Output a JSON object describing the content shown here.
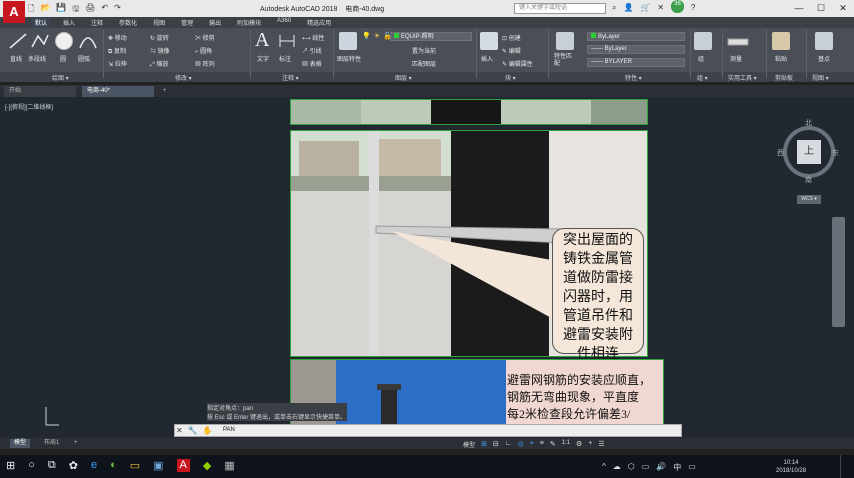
{
  "titlebar": {
    "app_logo": "A",
    "qat_icons": [
      "new-icon",
      "open-icon",
      "save-icon",
      "saveas-icon",
      "print-icon",
      "undo-icon",
      "redo-icon"
    ],
    "qat_glyphs": [
      "🗋",
      "📂",
      "💾",
      "🖫",
      "🖨",
      "↶",
      "↷"
    ],
    "title": "Autodesk AutoCAD 2018    电商-40.dwg",
    "search_placeholder": "键入关键字或短语",
    "badge_count": "36",
    "controls": [
      "—",
      "☐",
      "✕"
    ]
  },
  "ribbon_tabs": [
    "默认",
    "插入",
    "注释",
    "参数化",
    "视图",
    "管理",
    "输出",
    "附加模块",
    "A360",
    "精选应用"
  ],
  "ribbon": {
    "draw": {
      "title": "绘图 ▾",
      "line": "直线",
      "polyline": "多段线",
      "circle": "圆",
      "arc": "圆弧"
    },
    "modify": {
      "title": "修改 ▾",
      "move": "移动",
      "rotate": "旋转",
      "trim": "修剪",
      "copy": "复制",
      "mirror": "镜像",
      "fillet": "圆角",
      "stretch": "拉伸",
      "scale": "缩放",
      "array": "阵列"
    },
    "annotation": {
      "title": "注释 ▾",
      "text": "文字",
      "dimension": "标注",
      "linear": "线性",
      "leader": "引线",
      "table": "表格"
    },
    "layers": {
      "title": "图层 ▾",
      "layer_props": "图层特性",
      "current_layer": "EQUIP-照明",
      "make_current": "置为当前",
      "match_layer": "匹配图层"
    },
    "block": {
      "title": "块 ▾",
      "insert": "插入",
      "create": "创建",
      "edit": "编辑",
      "edit_attr": "编辑属性"
    },
    "properties": {
      "title": "特性 ▾",
      "match": "特性匹配",
      "color": "ByLayer",
      "linetype": "ByLayer",
      "lineweight": "BYLAYER"
    },
    "groups": {
      "title": "组 ▾",
      "group": "组"
    },
    "utilities": {
      "title": "实用工具 ▾",
      "measure": "测量"
    },
    "clipboard": {
      "title": "剪贴板",
      "paste": "粘贴"
    },
    "view": {
      "title": "视图 ▾",
      "base": "基点"
    }
  },
  "doc_tabs": {
    "start": "开始",
    "active": "电商-40*",
    "new_tab": "+"
  },
  "viewport_label": "[-][俯视][二维线框]",
  "callouts": {
    "middle": [
      "突出屋面的",
      "铸铁金属管",
      "道做防雷接",
      "闪器时，用",
      "管道吊件和",
      "避雷安装附",
      "件相连"
    ],
    "bottom": [
      "避雷网钢筋的安装应顺直，",
      "钢筋无弯曲现象，平直度",
      "每2米检查段允许偏差3/"
    ]
  },
  "viewcube": {
    "north": "北",
    "south": "南",
    "west": "西",
    "east": "东",
    "top": "上",
    "wcs": "WCS ▾"
  },
  "command": {
    "history": [
      "指定对角点：pan",
      "按 Esc 或 Enter 键退出，或单击右键显示快捷菜单。"
    ],
    "prompt_icon": "✋",
    "current": "PAN"
  },
  "layout_tabs": [
    "模型",
    "布局1",
    "+"
  ],
  "status_icons": [
    "⊞",
    "⊟",
    "∟",
    "◎",
    "⌖",
    "≡",
    "✎",
    "1:1",
    "⚙",
    "+",
    "☰"
  ],
  "taskbar": {
    "icons": [
      "⊞",
      "○",
      "⧉",
      "✿",
      "e",
      "◐",
      "▭",
      "▣",
      "A",
      "◆",
      "▦"
    ],
    "tray": [
      "^",
      "☁",
      "⬡",
      "▭",
      "🔊",
      "中",
      "▭"
    ],
    "time": "10:14",
    "date": "2018/10/28"
  }
}
